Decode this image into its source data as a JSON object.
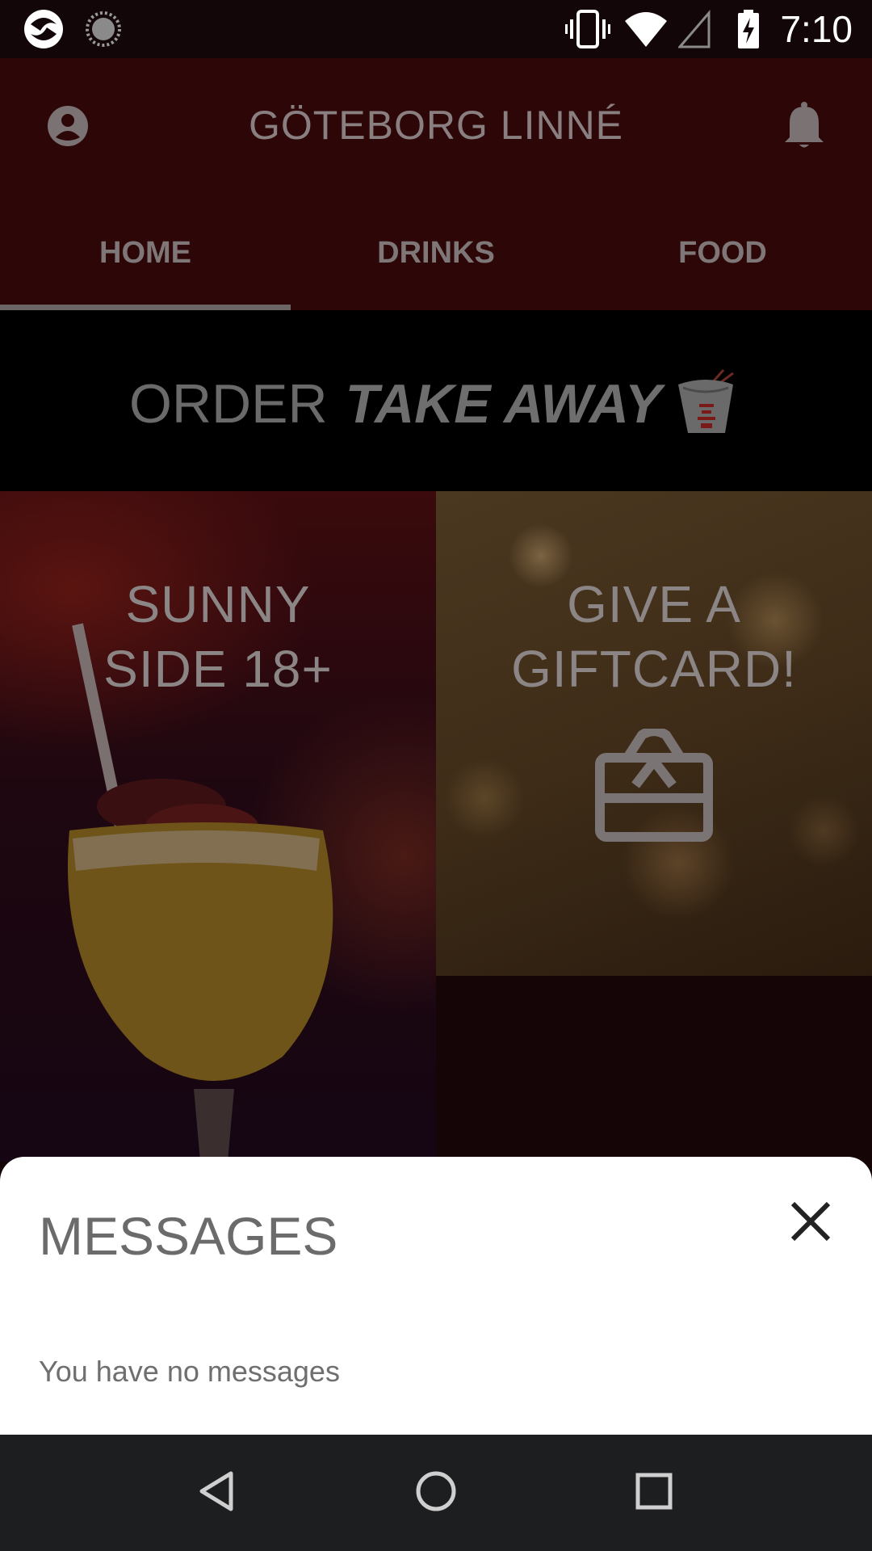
{
  "status_bar": {
    "time": "7:10",
    "icons": [
      "app-icon",
      "sync-icon",
      "vibrate-icon",
      "wifi-icon",
      "signal-icon",
      "battery-charging-icon"
    ]
  },
  "app_bar": {
    "title": "GÖTEBORG LINNÉ",
    "left_icon": "account-icon",
    "right_icon": "bell-icon"
  },
  "tabs": [
    {
      "label": "HOME",
      "selected": true
    },
    {
      "label": "DRINKS",
      "selected": false
    },
    {
      "label": "FOOD",
      "selected": false
    }
  ],
  "banner": {
    "text_prefix": "ORDER",
    "text_emphasis": "TAKE AWAY",
    "icon": "takeaway-box-icon"
  },
  "tiles": {
    "sunny": {
      "line1": "SUNNY",
      "line2": "SIDE 18+"
    },
    "gift": {
      "line1": "GIVE A",
      "line2": "GIFTCARD!",
      "icon": "gift-card-icon"
    }
  },
  "messages_sheet": {
    "title": "MESSAGES",
    "empty_text": "You have no messages",
    "close_icon": "close-icon"
  },
  "nav_bar": {
    "buttons": [
      "back-icon",
      "home-icon",
      "recents-icon"
    ]
  }
}
